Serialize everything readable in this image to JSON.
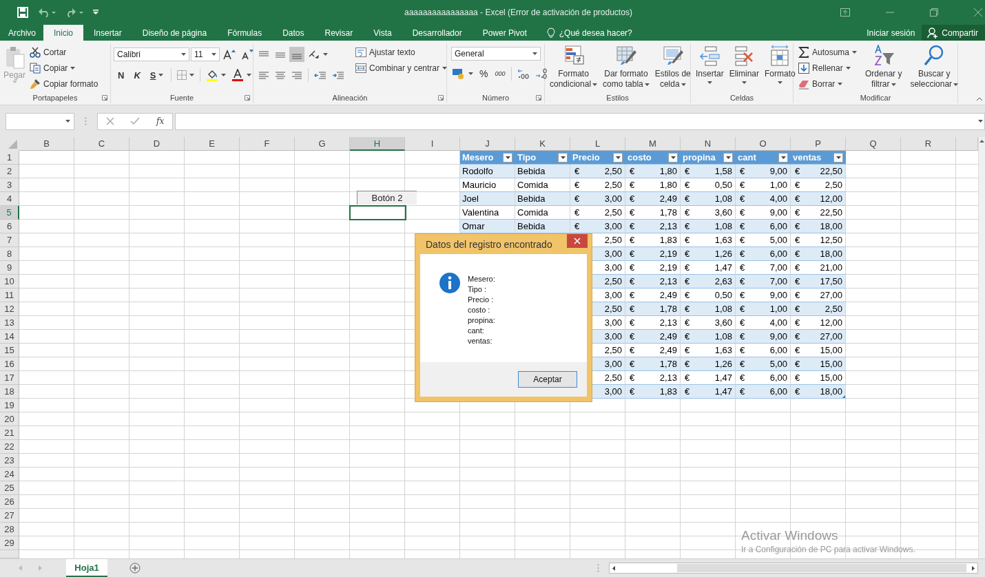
{
  "window": {
    "title": "aaaaaaaaaaaaaaaa - Excel (Error de activación de productos)"
  },
  "menu_tabs": [
    {
      "label": "Archivo",
      "selected": false
    },
    {
      "label": "Inicio",
      "selected": true
    },
    {
      "label": "Insertar",
      "selected": false
    },
    {
      "label": "Diseño de página",
      "selected": false
    },
    {
      "label": "Fórmulas",
      "selected": false
    },
    {
      "label": "Datos",
      "selected": false
    },
    {
      "label": "Revisar",
      "selected": false
    },
    {
      "label": "Vista",
      "selected": false
    },
    {
      "label": "Desarrollador",
      "selected": false
    },
    {
      "label": "Power Pivot",
      "selected": false
    }
  ],
  "tell_me": "¿Qué desea hacer?",
  "sign_in": "Iniciar sesión",
  "share": "Compartir",
  "ribbon": {
    "groups": [
      {
        "kind": "clipboard",
        "label": "Portapapeles",
        "paste": {
          "label": "Pegar",
          "disabled": true
        },
        "items": [
          "Cortar",
          "Copiar",
          "Copiar formato"
        ]
      },
      {
        "kind": "font",
        "label": "Fuente",
        "font_name": "Calibri",
        "font_size": "11",
        "styles": [
          "N",
          "K",
          "S"
        ]
      },
      {
        "kind": "alignment",
        "label": "Alineación",
        "items": [
          "Ajustar texto",
          "Combinar y centrar"
        ]
      },
      {
        "kind": "number",
        "label": "Número",
        "format": "General",
        "symbols": [
          "%",
          "000"
        ]
      },
      {
        "kind": "big",
        "label": "Estilos",
        "items": [
          {
            "lines": [
              "Formato",
              "condicional"
            ]
          },
          {
            "lines": [
              "Dar formato",
              "como tabla"
            ]
          },
          {
            "lines": [
              "Estilos de",
              "celda"
            ]
          }
        ]
      },
      {
        "kind": "big",
        "label": "Celdas",
        "items": [
          {
            "lines": [
              "Insertar"
            ]
          },
          {
            "lines": [
              "Eliminar"
            ]
          },
          {
            "lines": [
              "Formato"
            ]
          }
        ]
      },
      {
        "kind": "editing",
        "label": "Modificar",
        "items": [
          "Autosuma",
          "Rellenar",
          "Borrar"
        ],
        "big": [
          {
            "lines": [
              "Ordenar y",
              "filtrar"
            ]
          },
          {
            "lines": [
              "Buscar y",
              "seleccionar"
            ]
          }
        ]
      }
    ]
  },
  "formula_bar": {
    "function_label": "fx"
  },
  "sheet": {
    "columns": [
      {
        "label": "B",
        "selected": false
      },
      {
        "label": "C",
        "selected": false
      },
      {
        "label": "D",
        "selected": false
      },
      {
        "label": "E",
        "selected": false
      },
      {
        "label": "F",
        "selected": false
      },
      {
        "label": "G",
        "selected": false
      },
      {
        "label": "H",
        "selected": true
      },
      {
        "label": "I",
        "selected": false
      },
      {
        "label": "J",
        "selected": false
      },
      {
        "label": "K",
        "selected": false
      },
      {
        "label": "L",
        "selected": false
      },
      {
        "label": "M",
        "selected": false
      },
      {
        "label": "N",
        "selected": false
      },
      {
        "label": "O",
        "selected": false
      },
      {
        "label": "P",
        "selected": false
      },
      {
        "label": "Q",
        "selected": false
      },
      {
        "label": "R",
        "selected": false
      }
    ],
    "rows": [
      {
        "label": "1",
        "selected": false
      },
      {
        "label": "2",
        "selected": false
      },
      {
        "label": "3",
        "selected": false
      },
      {
        "label": "4",
        "selected": false
      },
      {
        "label": "5",
        "selected": true
      },
      {
        "label": "6",
        "selected": false
      },
      {
        "label": "7",
        "selected": false
      },
      {
        "label": "8",
        "selected": false
      },
      {
        "label": "9",
        "selected": false
      },
      {
        "label": "10",
        "selected": false
      },
      {
        "label": "11",
        "selected": false
      },
      {
        "label": "12",
        "selected": false
      },
      {
        "label": "13",
        "selected": false
      },
      {
        "label": "14",
        "selected": false
      },
      {
        "label": "15",
        "selected": false
      },
      {
        "label": "16",
        "selected": false
      },
      {
        "label": "17",
        "selected": false
      },
      {
        "label": "18",
        "selected": false
      },
      {
        "label": "19",
        "selected": false
      },
      {
        "label": "20",
        "selected": false
      },
      {
        "label": "21",
        "selected": false
      },
      {
        "label": "22",
        "selected": false
      },
      {
        "label": "23",
        "selected": false
      },
      {
        "label": "24",
        "selected": false
      },
      {
        "label": "25",
        "selected": false
      },
      {
        "label": "26",
        "selected": false
      },
      {
        "label": "27",
        "selected": false
      },
      {
        "label": "28",
        "selected": false
      },
      {
        "label": "29",
        "selected": false
      }
    ],
    "form_button": "Botón 2",
    "table": {
      "headers": [
        "Mesero",
        "Tipo",
        "Precio",
        "costo",
        "propina",
        "cant",
        "ventas"
      ],
      "rows": [
        {
          "mesero": "Rodolfo",
          "tipo": "Bebida",
          "amounts": [
            {
              "currency": "€",
              "value": "2,50"
            },
            {
              "currency": "€",
              "value": "1,80"
            },
            {
              "currency": "€",
              "value": "1,58"
            },
            {
              "currency": "€",
              "value": "9,00"
            },
            {
              "currency": "€",
              "value": "22,50"
            }
          ]
        },
        {
          "mesero": "Mauricio",
          "tipo": "Comida",
          "amounts": [
            {
              "currency": "€",
              "value": "2,50"
            },
            {
              "currency": "€",
              "value": "1,80"
            },
            {
              "currency": "€",
              "value": "0,50"
            },
            {
              "currency": "€",
              "value": "1,00"
            },
            {
              "currency": "€",
              "value": "2,50"
            }
          ]
        },
        {
          "mesero": "Joel",
          "tipo": "Bebida",
          "amounts": [
            {
              "currency": "€",
              "value": "3,00"
            },
            {
              "currency": "€",
              "value": "2,49"
            },
            {
              "currency": "€",
              "value": "1,08"
            },
            {
              "currency": "€",
              "value": "4,00"
            },
            {
              "currency": "€",
              "value": "12,00"
            }
          ]
        },
        {
          "mesero": "Valentina",
          "tipo": "Comida",
          "amounts": [
            {
              "currency": "€",
              "value": "2,50"
            },
            {
              "currency": "€",
              "value": "1,78"
            },
            {
              "currency": "€",
              "value": "3,60"
            },
            {
              "currency": "€",
              "value": "9,00"
            },
            {
              "currency": "€",
              "value": "22,50"
            }
          ]
        },
        {
          "mesero": "Omar",
          "tipo": "Bebida",
          "amounts": [
            {
              "currency": "€",
              "value": "3,00"
            },
            {
              "currency": "€",
              "value": "2,13"
            },
            {
              "currency": "€",
              "value": "1,08"
            },
            {
              "currency": "€",
              "value": "6,00"
            },
            {
              "currency": "€",
              "value": "18,00"
            }
          ]
        },
        {
          "amounts": [
            {
              "value": "2,50"
            },
            {
              "currency": "€",
              "value": "1,83"
            },
            {
              "currency": "€",
              "value": "1,63"
            },
            {
              "currency": "€",
              "value": "5,00"
            },
            {
              "currency": "€",
              "value": "12,50"
            }
          ]
        },
        {
          "amounts": [
            {
              "value": "3,00"
            },
            {
              "currency": "€",
              "value": "2,19"
            },
            {
              "currency": "€",
              "value": "1,26"
            },
            {
              "currency": "€",
              "value": "6,00"
            },
            {
              "currency": "€",
              "value": "18,00"
            }
          ]
        },
        {
          "amounts": [
            {
              "value": "3,00"
            },
            {
              "currency": "€",
              "value": "2,19"
            },
            {
              "currency": "€",
              "value": "1,47"
            },
            {
              "currency": "€",
              "value": "7,00"
            },
            {
              "currency": "€",
              "value": "21,00"
            }
          ]
        },
        {
          "amounts": [
            {
              "value": "2,50"
            },
            {
              "currency": "€",
              "value": "2,13"
            },
            {
              "currency": "€",
              "value": "2,63"
            },
            {
              "currency": "€",
              "value": "7,00"
            },
            {
              "currency": "€",
              "value": "17,50"
            }
          ]
        },
        {
          "amounts": [
            {
              "value": "3,00"
            },
            {
              "currency": "€",
              "value": "2,49"
            },
            {
              "currency": "€",
              "value": "0,50"
            },
            {
              "currency": "€",
              "value": "9,00"
            },
            {
              "currency": "€",
              "value": "27,00"
            }
          ]
        },
        {
          "amounts": [
            {
              "value": "2,50"
            },
            {
              "currency": "€",
              "value": "1,78"
            },
            {
              "currency": "€",
              "value": "1,08"
            },
            {
              "currency": "€",
              "value": "1,00"
            },
            {
              "currency": "€",
              "value": "2,50"
            }
          ]
        },
        {
          "amounts": [
            {
              "value": "3,00"
            },
            {
              "currency": "€",
              "value": "2,13"
            },
            {
              "currency": "€",
              "value": "3,60"
            },
            {
              "currency": "€",
              "value": "4,00"
            },
            {
              "currency": "€",
              "value": "12,00"
            }
          ]
        },
        {
          "amounts": [
            {
              "value": "3,00"
            },
            {
              "currency": "€",
              "value": "2,49"
            },
            {
              "currency": "€",
              "value": "1,08"
            },
            {
              "currency": "€",
              "value": "9,00"
            },
            {
              "currency": "€",
              "value": "27,00"
            }
          ]
        },
        {
          "amounts": [
            {
              "value": "2,50"
            },
            {
              "currency": "€",
              "value": "2,49"
            },
            {
              "currency": "€",
              "value": "1,63"
            },
            {
              "currency": "€",
              "value": "6,00"
            },
            {
              "currency": "€",
              "value": "15,00"
            }
          ]
        },
        {
          "amounts": [
            {
              "value": "3,00"
            },
            {
              "currency": "€",
              "value": "1,78"
            },
            {
              "currency": "€",
              "value": "1,26"
            },
            {
              "currency": "€",
              "value": "5,00"
            },
            {
              "currency": "€",
              "value": "15,00"
            }
          ]
        },
        {
          "amounts": [
            {
              "value": "2,50"
            },
            {
              "currency": "€",
              "value": "2,13"
            },
            {
              "currency": "€",
              "value": "1,47"
            },
            {
              "currency": "€",
              "value": "6,00"
            },
            {
              "currency": "€",
              "value": "15,00"
            }
          ]
        },
        {
          "amounts": [
            {
              "value": "3,00"
            },
            {
              "currency": "€",
              "value": "1,83"
            },
            {
              "currency": "€",
              "value": "1,47"
            },
            {
              "currency": "€",
              "value": "6,00"
            },
            {
              "currency": "€",
              "value": "18,00"
            }
          ]
        }
      ]
    }
  },
  "dialog": {
    "title": "Datos del registro encontrado",
    "lines": [
      "Mesero:",
      "Tipo :",
      "Precio :",
      "costo :",
      "propina:",
      "cant:",
      "ventas:"
    ],
    "button": "Aceptar"
  },
  "sheet_tabs": [
    {
      "label": "Hoja1",
      "selected": true
    }
  ],
  "activation_notice": {
    "title": "Activar Windows",
    "detail": "Ir a Configuración de PC para activar Windows."
  }
}
